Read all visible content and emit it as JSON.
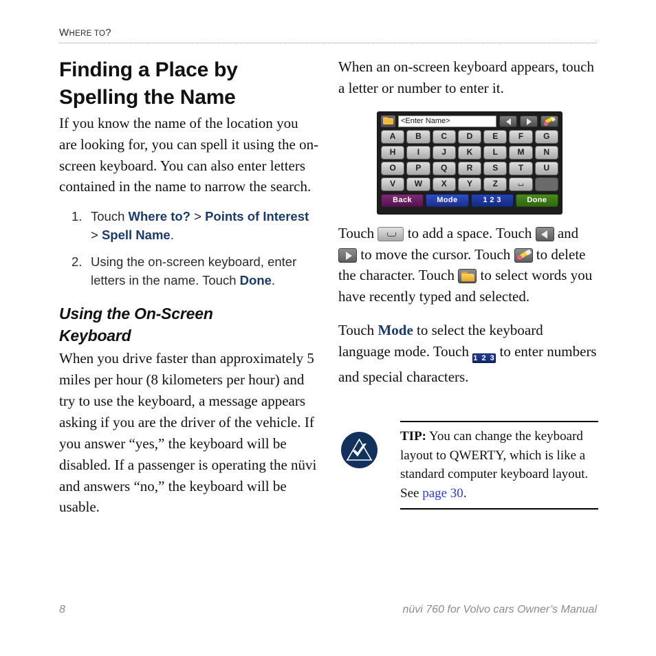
{
  "running_head": {
    "first_letter": "W",
    "rest_small_caps": "HERE TO",
    "question_mark": "?",
    "full_text": "Where to?"
  },
  "left_column": {
    "title_line1": "Finding a Place by",
    "title_line2": "Spelling the Name",
    "intro_paragraph": "If you know the name of the location you are looking for, you can spell it using the on-screen keyboard. You can also enter letters contained in the name to narrow the search.",
    "steps": [
      {
        "number": "1.",
        "prefix": "Touch ",
        "nav1": "Where to?",
        "sep1": " > ",
        "nav2": "Points of Interest",
        "sep2": " > ",
        "nav3": "Spell Name",
        "suffix": "."
      },
      {
        "number": "2.",
        "prefix": "Using the on-screen keyboard, enter letters in the name. Touch ",
        "nav1": "Done",
        "suffix": "."
      }
    ],
    "subhead_line1": "Using the On-Screen",
    "subhead_line2": "Keyboard",
    "subhead_paragraph": "When you drive faster than approximately 5 miles per hour (8 kilometers per hour) and try to use the keyboard, a message appears asking if you are the driver of the vehicle. If you answer “yes,” the keyboard will be disabled. If a passenger is operating the nüvi and answers “no,” the keyboard will be usable."
  },
  "right_column": {
    "intro_paragraph": "When an on-screen keyboard appears, touch a letter or number to enter it.",
    "icons_paragraph": {
      "part1": "Touch ",
      "part2": " to add a space. Touch ",
      "part3": " and ",
      "part4": " to move the cursor. Touch ",
      "part5": " to delete the character. Touch ",
      "part6": " to select words you have recently typed and selected."
    },
    "mode_paragraph": {
      "part1": "Touch ",
      "mode_bold": "Mode",
      "part2": " to select the keyboard language mode. Touch ",
      "part3": " to enter numbers and special characters."
    }
  },
  "keyboard_figure": {
    "entry_value": "<Enter Name>",
    "entry_placeholder": "<Enter Name>",
    "folder_icon": "folder-icon",
    "left_arrow_icon": "arrow-left-icon",
    "right_arrow_icon": "arrow-right-icon",
    "pencil_icon": "pencil-delete-icon",
    "rows": [
      [
        "A",
        "B",
        "C",
        "D",
        "E",
        "F",
        "G"
      ],
      [
        "H",
        "I",
        "J",
        "K",
        "L",
        "M",
        "N"
      ],
      [
        "O",
        "P",
        "Q",
        "R",
        "S",
        "T",
        "U"
      ],
      [
        "V",
        "W",
        "X",
        "Y",
        "Z",
        "⌴",
        ""
      ]
    ],
    "space_key_label": "⌴",
    "bottom_keys": [
      {
        "label": "Back",
        "color": "#58124f"
      },
      {
        "label": "Mode",
        "color": "#1b2f8e"
      },
      {
        "label": "1 2 3",
        "color": "#152a7d"
      },
      {
        "label": "Done",
        "color": "#2f6610"
      }
    ]
  },
  "inline_icons": {
    "space": "space-bar-icon",
    "left": "arrow-left-icon",
    "right": "arrow-right-icon",
    "pencil": "pencil-delete-icon",
    "folder": "folder-icon",
    "num_button_label": "1 2 3"
  },
  "tip_box": {
    "icon_name": "tip-note-icon",
    "label": "TIP:",
    "text_before_link": " You can change the keyboard layout to QWERTY, which is like a standard computer keyboard layout. See ",
    "link_text": "page 30",
    "text_after_link": "."
  },
  "footer": {
    "page_number": "8",
    "manual_title": "nüvi 760 for Volvo cars Owner’s Manual"
  },
  "colors": {
    "nav_blue": "#1b3a66",
    "link_blue": "#2b3ecb",
    "tip_navy": "#12315c",
    "footer_gray": "#8c8c8c",
    "rule_gray": "#9a9a9a"
  }
}
